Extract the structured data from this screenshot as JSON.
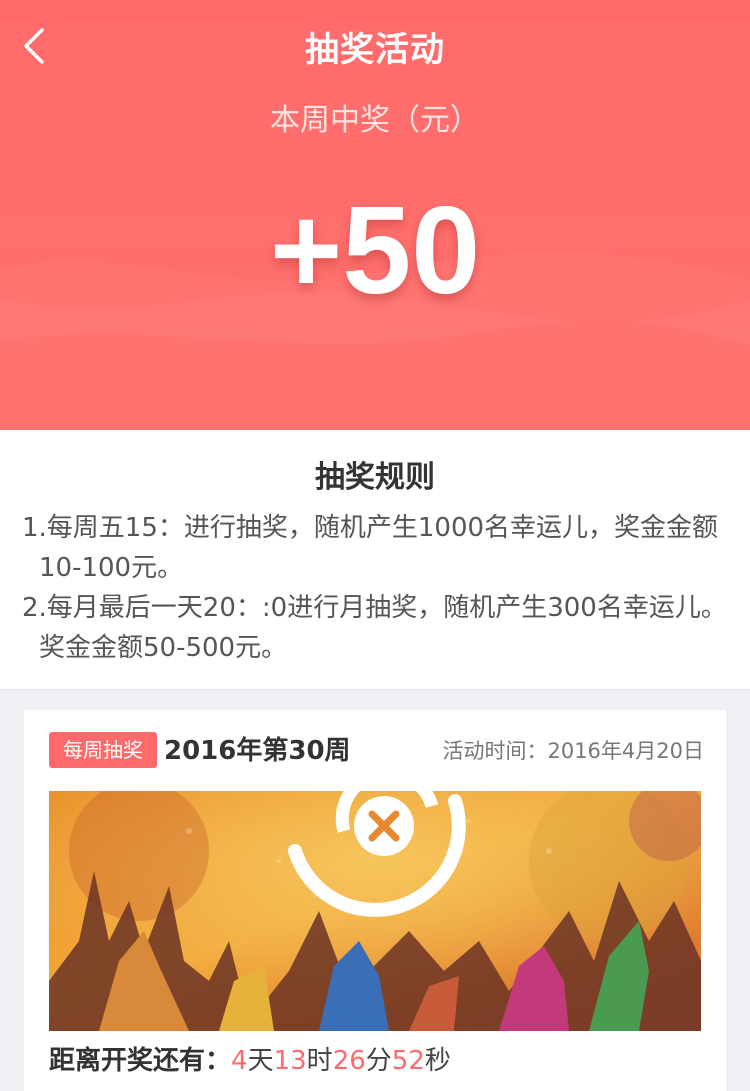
{
  "header": {
    "title": "抽奖活动"
  },
  "prize": {
    "label": "本周中奖（元）",
    "amount": "+50"
  },
  "rules": {
    "title": "抽奖规则",
    "items": [
      {
        "line1": "1.每周五15：进行抽奖，随机产生1000名幸运儿，奖金金额",
        "line2": "10-100元。"
      },
      {
        "line1": "2.每月最后一天20：:0进行月抽奖，随机产生300名幸运儿。",
        "line2": "奖金金额50-500元。"
      }
    ]
  },
  "activity": {
    "badge": "每周抽奖",
    "period": "2016年第30周",
    "time_label": "活动时间：",
    "time_value": "2016年4月20日",
    "countdown": {
      "label": "距离开奖还有：",
      "days": "4",
      "days_unit": "天",
      "hours": "13",
      "hours_unit": "时",
      "minutes": "26",
      "minutes_unit": "分",
      "seconds": "52",
      "seconds_unit": "秒"
    }
  },
  "icons": {
    "back": "back-arrow-icon",
    "logo": "lottery-logo-icon"
  },
  "colors": {
    "accent": "#fc6a6c",
    "hero": "#ff6b6b",
    "text": "#333333"
  }
}
